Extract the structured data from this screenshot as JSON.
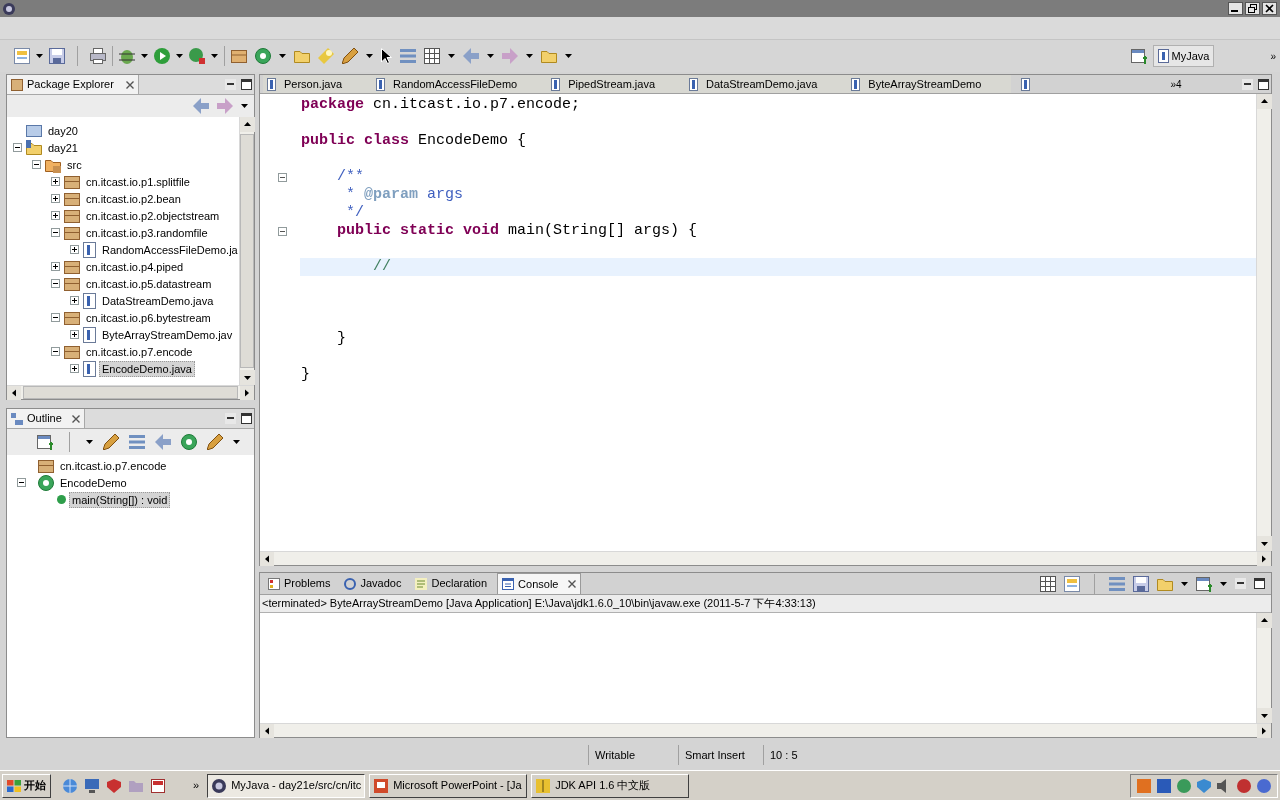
{
  "toolbar": {
    "perspective": "MyJava",
    "overflow": "»"
  },
  "package_explorer": {
    "title": "Package Explorer",
    "tree": [
      {
        "label": "day20",
        "kind": "closed_project",
        "selected": false
      },
      {
        "label": "day21",
        "kind": "project",
        "expanded": true,
        "selected": false,
        "children": [
          {
            "label": "src",
            "kind": "source_folder",
            "expanded": true,
            "selected": false,
            "children": [
              {
                "label": "cn.itcast.io.p1.splitfile",
                "kind": "package",
                "expanded": false,
                "selected": false
              },
              {
                "label": "cn.itcast.io.p2.bean",
                "kind": "package",
                "expanded": false,
                "selected": false
              },
              {
                "label": "cn.itcast.io.p2.objectstream",
                "kind": "package",
                "expanded": false,
                "selected": false
              },
              {
                "label": "cn.itcast.io.p3.randomfile",
                "kind": "package",
                "expanded": true,
                "selected": false,
                "children": [
                  {
                    "label": "RandomAccessFileDemo.ja",
                    "kind": "java_file",
                    "expanded": false,
                    "selected": false
                  }
                ]
              },
              {
                "label": "cn.itcast.io.p4.piped",
                "kind": "package",
                "expanded": false,
                "selected": false
              },
              {
                "label": "cn.itcast.io.p5.datastream",
                "kind": "package",
                "expanded": true,
                "selected": false,
                "children": [
                  {
                    "label": "DataStreamDemo.java",
                    "kind": "java_file",
                    "expanded": false,
                    "selected": false
                  }
                ]
              },
              {
                "label": "cn.itcast.io.p6.bytestream",
                "kind": "package",
                "expanded": true,
                "selected": false,
                "children": [
                  {
                    "label": "ByteArrayStreamDemo.jav",
                    "kind": "java_file",
                    "expanded": false,
                    "selected": false
                  }
                ]
              },
              {
                "label": "cn.itcast.io.p7.encode",
                "kind": "package",
                "expanded": true,
                "selected": false,
                "children": [
                  {
                    "label": "EncodeDemo.java",
                    "kind": "java_file",
                    "expanded": false,
                    "selected": true
                  }
                ]
              }
            ]
          }
        ]
      }
    ]
  },
  "outline": {
    "title": "Outline",
    "tree": [
      {
        "label": "cn.itcast.io.p7.encode",
        "kind": "package",
        "selected": false
      },
      {
        "label": "EncodeDemo",
        "kind": "class",
        "expanded": true,
        "selected": false,
        "children": [
          {
            "label": "main(String[]) : void",
            "kind": "method",
            "selected": true
          }
        ]
      }
    ]
  },
  "editor": {
    "tabs": [
      {
        "label": "Person.java",
        "selected": false
      },
      {
        "label": "RandomAccessFileDemo",
        "selected": false
      },
      {
        "label": "PipedStream.java",
        "selected": false
      },
      {
        "label": "DataStreamDemo.java",
        "selected": false
      },
      {
        "label": "ByteArrayStreamDemo",
        "selected": false
      }
    ],
    "overflow": "»4",
    "lines": [
      {
        "current": false,
        "tokens": [
          {
            "text": "package",
            "kind": "keyword"
          },
          {
            "text": " cn.itcast.io.p7.encode;",
            "kind": "plain"
          }
        ]
      },
      {
        "current": false
      },
      {
        "current": false,
        "tokens": [
          {
            "text": "public class",
            "kind": "keyword"
          },
          {
            "text": " EncodeDemo {",
            "kind": "plain"
          }
        ]
      },
      {
        "current": false
      },
      {
        "current": false,
        "fold": true,
        "tokens": [
          {
            "text": "    /**",
            "kind": "javadoc"
          }
        ]
      },
      {
        "current": false,
        "tokens": [
          {
            "text": "     * ",
            "kind": "javadoc"
          },
          {
            "text": "@param",
            "kind": "javadoc_tag"
          },
          {
            "text": " args",
            "kind": "javadoc"
          }
        ]
      },
      {
        "current": false,
        "tokens": [
          {
            "text": "     */",
            "kind": "javadoc"
          }
        ]
      },
      {
        "current": false,
        "fold": true,
        "tokens": [
          {
            "text": "    public static void",
            "kind": "keyword"
          },
          {
            "text": " main(String[] args) {",
            "kind": "plain"
          }
        ]
      },
      {
        "current": false
      },
      {
        "current": true,
        "tokens": [
          {
            "text": "        //",
            "kind": "comment"
          }
        ]
      },
      {
        "current": false
      },
      {
        "current": false
      },
      {
        "current": false
      },
      {
        "current": false,
        "tokens": [
          {
            "text": "    }",
            "kind": "plain"
          }
        ]
      },
      {
        "current": false
      },
      {
        "current": false,
        "tokens": [
          {
            "text": "}",
            "kind": "plain"
          }
        ]
      }
    ]
  },
  "bottom_panel": {
    "tabs": [
      {
        "label": "Problems",
        "kind": "problems",
        "selected": false
      },
      {
        "label": "Javadoc",
        "kind": "javadoc",
        "selected": false
      },
      {
        "label": "Declaration",
        "kind": "declaration",
        "selected": false
      },
      {
        "label": "Console",
        "kind": "console",
        "selected": true
      }
    ],
    "console_header": "<terminated> ByteArrayStreamDemo [Java Application] E:\\Java\\jdk1.6.0_10\\bin\\javaw.exe (2011-5-7 下午4:33:13)"
  },
  "status_bar": {
    "fields": [
      "Writable",
      "Smart Insert",
      "10 : 5"
    ]
  },
  "taskbar": {
    "start": "开始",
    "overflow": "»",
    "tasks": [
      {
        "label": "MyJava - day21e/src/cn/itc",
        "kind": "ide",
        "selected": true
      },
      {
        "label": "Microsoft PowerPoint - [Ja",
        "kind": "slides",
        "selected": false
      },
      {
        "label": "JDK API 1.6 中文版",
        "kind": "help",
        "selected": false
      }
    ]
  }
}
